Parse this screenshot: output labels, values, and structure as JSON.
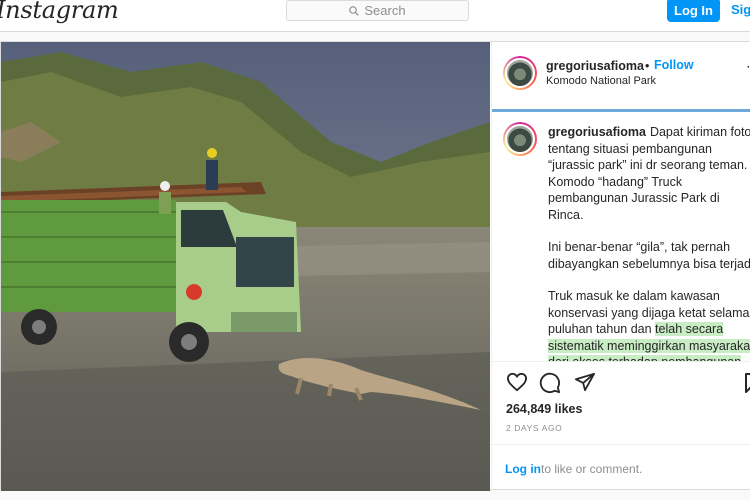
{
  "header": {
    "logo_text": "Instagram",
    "search_placeholder": "Search",
    "login_label": "Log In",
    "signup_label": "Sign Up"
  },
  "post": {
    "username": "gregoriusafioma",
    "dot": "•",
    "follow_label": "Follow",
    "location": "Komodo National Park",
    "caption": {
      "p1": "Dapat kiriman foto tentang situasi pembangunan “jurassic park” ini dr seorang teman. Komodo “hadang” Truck pembangunan Jurassic Park di Rinca.",
      "p2": "Ini benar-benar “gila”, tak pernah dibayangkan sebelumnya bisa terjadi.",
      "p3_plain": "Truk masuk ke dalam kawasan konservasi yang dijaga ketat selama puluhan tahun dan ",
      "p3_highlight": "telah secara sistematik meminggirkan masyarakat dari akses terhadap pembangunan yang layak demi konservasi."
    },
    "likes": "264,849 likes",
    "date": "2 DAYS AGO",
    "footer": {
      "login_link": "Log in",
      "rest": "to like or comment."
    }
  },
  "icons": [
    "search-icon",
    "heart-icon",
    "comment-icon",
    "share-icon",
    "bookmark-icon",
    "more-icon"
  ],
  "colors": {
    "accent": "#0095f6",
    "highlight": "#c8ecc3"
  }
}
